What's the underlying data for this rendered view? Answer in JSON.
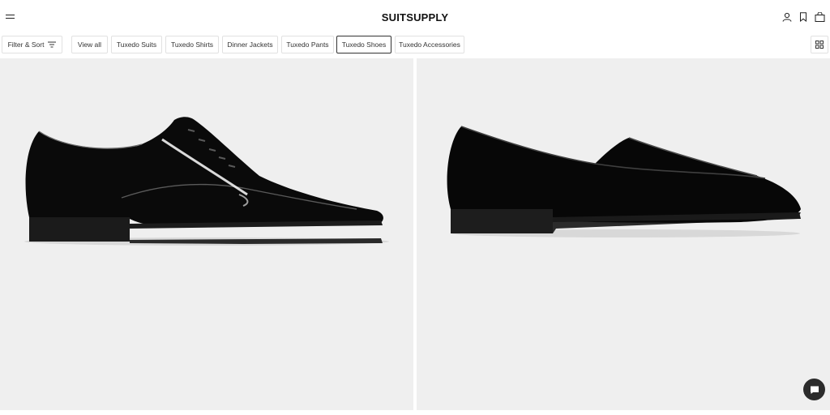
{
  "header": {
    "logo": "SUITSUPPLY",
    "menu_icon": "hamburger-icon",
    "account_icon": "user-icon",
    "wishlist_icon": "bookmark-icon",
    "bag_icon": "shopping-bag-icon"
  },
  "filters": {
    "filter_sort_label": "Filter & Sort",
    "filter_icon": "sliders-icon",
    "categories": [
      {
        "label": "View all",
        "active": false
      },
      {
        "label": "Tuxedo Suits",
        "active": false
      },
      {
        "label": "Tuxedo Shirts",
        "active": false
      },
      {
        "label": "Dinner Jackets",
        "active": false
      },
      {
        "label": "Tuxedo Pants",
        "active": false
      },
      {
        "label": "Tuxedo Shoes",
        "active": true
      },
      {
        "label": "Tuxedo Accessories",
        "active": false
      }
    ],
    "grid_toggle_icon": "grid-view-icon"
  },
  "products": [
    {
      "image": "black-patent-oxford-shoe"
    },
    {
      "image": "black-velvet-loafer-shoe"
    }
  ],
  "chat": {
    "icon": "chat-bubble-icon"
  },
  "colors": {
    "background": "#ffffff",
    "product_bg": "#efefef",
    "border": "#e1e1e1",
    "chat_bg": "#2b2b2b"
  }
}
